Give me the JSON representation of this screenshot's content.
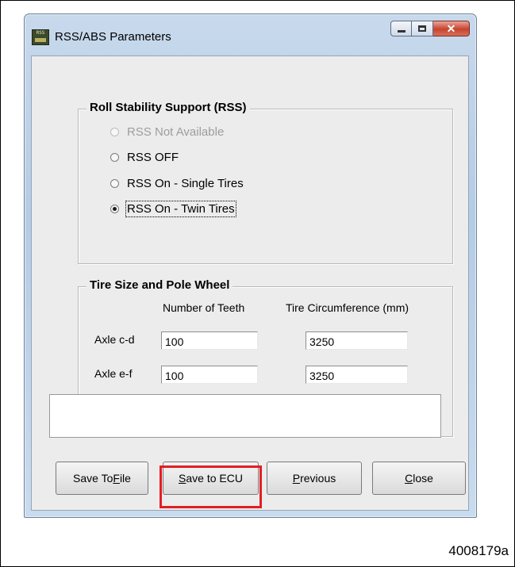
{
  "window": {
    "title": "RSS/ABS Parameters"
  },
  "rss_group": {
    "title": "Roll Stability Support (RSS)",
    "options": [
      {
        "label": "RSS Not Available",
        "selected": false,
        "enabled": false
      },
      {
        "label": "RSS OFF",
        "selected": false,
        "enabled": true
      },
      {
        "label": "RSS On - Single Tires",
        "selected": false,
        "enabled": true
      },
      {
        "label": "RSS On - Twin Tires",
        "selected": true,
        "enabled": true
      }
    ]
  },
  "tire_group": {
    "title": "Tire Size and Pole Wheel",
    "col_teeth": "Number of Teeth",
    "col_circumference": "Tire Circumference (mm)",
    "rows": [
      {
        "label": "Axle c-d",
        "teeth": "100",
        "circumference": "3250"
      },
      {
        "label": "Axle e-f",
        "teeth": "100",
        "circumference": "3250"
      }
    ]
  },
  "message": "",
  "buttons": {
    "save_file_pre": "Save To ",
    "save_file_u": "F",
    "save_file_post": "ile",
    "save_ecu_pre": "",
    "save_ecu_u": "S",
    "save_ecu_post": "ave to ECU",
    "previous_pre": "",
    "previous_u": "P",
    "previous_post": "revious",
    "close_pre": "",
    "close_u": "C",
    "close_post": "lose"
  },
  "highlight_color": "#e31e24",
  "figure_id": "4008179a"
}
